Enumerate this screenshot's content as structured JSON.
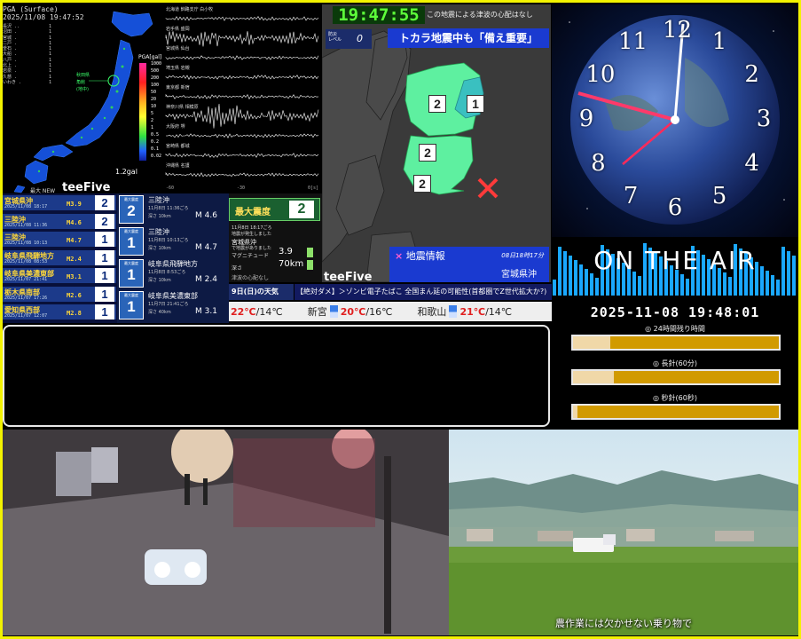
{
  "colors": {
    "frame": "#f2f200",
    "accent_blue": "#1a3ad0",
    "intensity_green": "#5ef0a0",
    "clock_green": "#5dff3a",
    "timer_bar": "#d19a00"
  },
  "seismic_map": {
    "header_line1": "PGA (Surface)",
    "header_line2": "2025/11/08 19:47:52",
    "pga_scale_title": "PGA[gal]",
    "scale_labels": [
      "1000",
      "500",
      "200",
      "100",
      "50",
      "20",
      "10",
      "5",
      "2",
      "1",
      "0.5",
      "0.2",
      "0.1",
      "0.02"
    ],
    "gal_value": "1.2gal",
    "logo": "teeFive",
    "new_label": "最大 NEW",
    "station_list": [
      {
        "name": "長沢 ..",
        "val": "1"
      },
      {
        "name": "沼田 .",
        "val": "1"
      },
      {
        "name": "宮城 .",
        "val": "1"
      },
      {
        "name": "二戸 .",
        "val": "1"
      },
      {
        "name": "釜石 .",
        "val": "1"
      },
      {
        "name": "大船 .",
        "val": "1"
      },
      {
        "name": "八戸 .",
        "val": "1"
      },
      {
        "name": "北上 .",
        "val": "1"
      },
      {
        "name": "岩泉 .",
        "val": "1"
      },
      {
        "name": "久慈 .",
        "val": "1"
      },
      {
        "name": "いわき .",
        "val": "1"
      }
    ]
  },
  "waveforms": {
    "stations": [
      "北海道 釧路支庁 白小牧",
      "岩手県 盛岡",
      "宮城県 仙台",
      "埼玉県 岩槻",
      "東京都 新宿",
      "神奈川県 相模原",
      "大阪府 堺",
      "宮崎県 都城",
      "沖縄県 名護"
    ],
    "axis_labels": [
      "-60",
      "-30",
      "0[s]"
    ]
  },
  "quake_list": [
    {
      "region": "宮城県沖",
      "datetime": "2025/11/08 18:17",
      "mag": "M3.9",
      "shindo": "2"
    },
    {
      "region": "三陸沖",
      "datetime": "2025/11/08 11:36",
      "mag": "M4.6",
      "shindo": "2"
    },
    {
      "region": "三陸沖",
      "datetime": "2025/11/08 10:13",
      "mag": "M4.7",
      "shindo": "1"
    },
    {
      "region": "岐阜県飛騨地方",
      "datetime": "2025/11/08 08:53",
      "mag": "M2.4",
      "shindo": "1"
    },
    {
      "region": "岐阜県美濃東部",
      "datetime": "2025/11/07 21:41",
      "mag": "M3.1",
      "shindo": "1"
    },
    {
      "region": "栃木県南部",
      "datetime": "2025/11/07 17:26",
      "mag": "M2.6",
      "shindo": "1"
    },
    {
      "region": "愛知県西部",
      "datetime": "2025/11/07 12:07",
      "mag": "M2.8",
      "shindo": "1"
    }
  ],
  "quake_cards": [
    {
      "label": "最大震度",
      "shindo": "2",
      "name": "三陸沖",
      "time": "11月8日 11:36ごろ",
      "depth": "深さ 10km",
      "mag": "M 4.6"
    },
    {
      "label": "最大震度",
      "shindo": "1",
      "name": "三陸沖",
      "time": "11月8日 10:13ごろ",
      "depth": "深さ 10km",
      "mag": "M 4.7"
    },
    {
      "label": "最大震度",
      "shindo": "1",
      "name": "岐阜県飛騨地方",
      "time": "11月8日 8:53ごろ",
      "depth": "深さ 10km",
      "mag": "M 2.4"
    },
    {
      "label": "最大震度",
      "shindo": "1",
      "name": "岐阜県美濃東部",
      "time": "11月7日 21:41ごろ",
      "depth": "深さ 40km",
      "mag": "M 3.1"
    }
  ],
  "max_intensity": {
    "label": "最大震度",
    "value": "2",
    "time": "11月8日 18:17ごろ",
    "sub": "地震が発生しました",
    "region": "宮城県沖",
    "region_sub": "で地震がありました",
    "magnitude_label": "マグニチュード",
    "magnitude": "3.9",
    "depth_label": "深さ",
    "depth": "70km",
    "tsunami": "津波の心配なし"
  },
  "regional_map": {
    "clock": "19:47:55",
    "notice": "この地震による津波の心配はなし",
    "level_label_1": "防災",
    "level_label_2": "レベル",
    "level_value": "0",
    "banner": "トカラ地震中も「備え重要」",
    "intensity_labels": [
      "2",
      "1",
      "2",
      "2"
    ],
    "info_title": "地震情報",
    "info_mark": "×",
    "info_date": "08日18時17分",
    "info_place": "宮城県沖",
    "logo": "teeFive"
  },
  "ticker": {
    "day_label": "9日(日)の天気",
    "news": "【絶対ダメ】＞ゾンビ電子たばこ 全国まん延の可能性(首都圏でZ世代拡大か?)",
    "weather": [
      {
        "city": "",
        "high": "22℃",
        "low": "14℃"
      },
      {
        "city": "新宮",
        "high": "20℃",
        "low": "16℃"
      },
      {
        "city": "和歌山",
        "high": "21℃",
        "low": "14℃"
      }
    ]
  },
  "clock_face": {
    "numbers": [
      "12",
      "1",
      "2",
      "3",
      "4",
      "5",
      "6",
      "7",
      "8",
      "9",
      "10",
      "11"
    ]
  },
  "on_air": {
    "title": "ON THE AIR",
    "datetime": "2025-11-08 19:48:01",
    "timers": [
      {
        "label": "◎ 24時間残り時間",
        "fraction": 0.18
      },
      {
        "label": "◎ 長針(60分)",
        "fraction": 0.2
      },
      {
        "label": "◎ 秒針(60秒)",
        "fraction": 0.02
      }
    ]
  },
  "countryside_caption": "農作業には欠かせない乗り物で"
}
